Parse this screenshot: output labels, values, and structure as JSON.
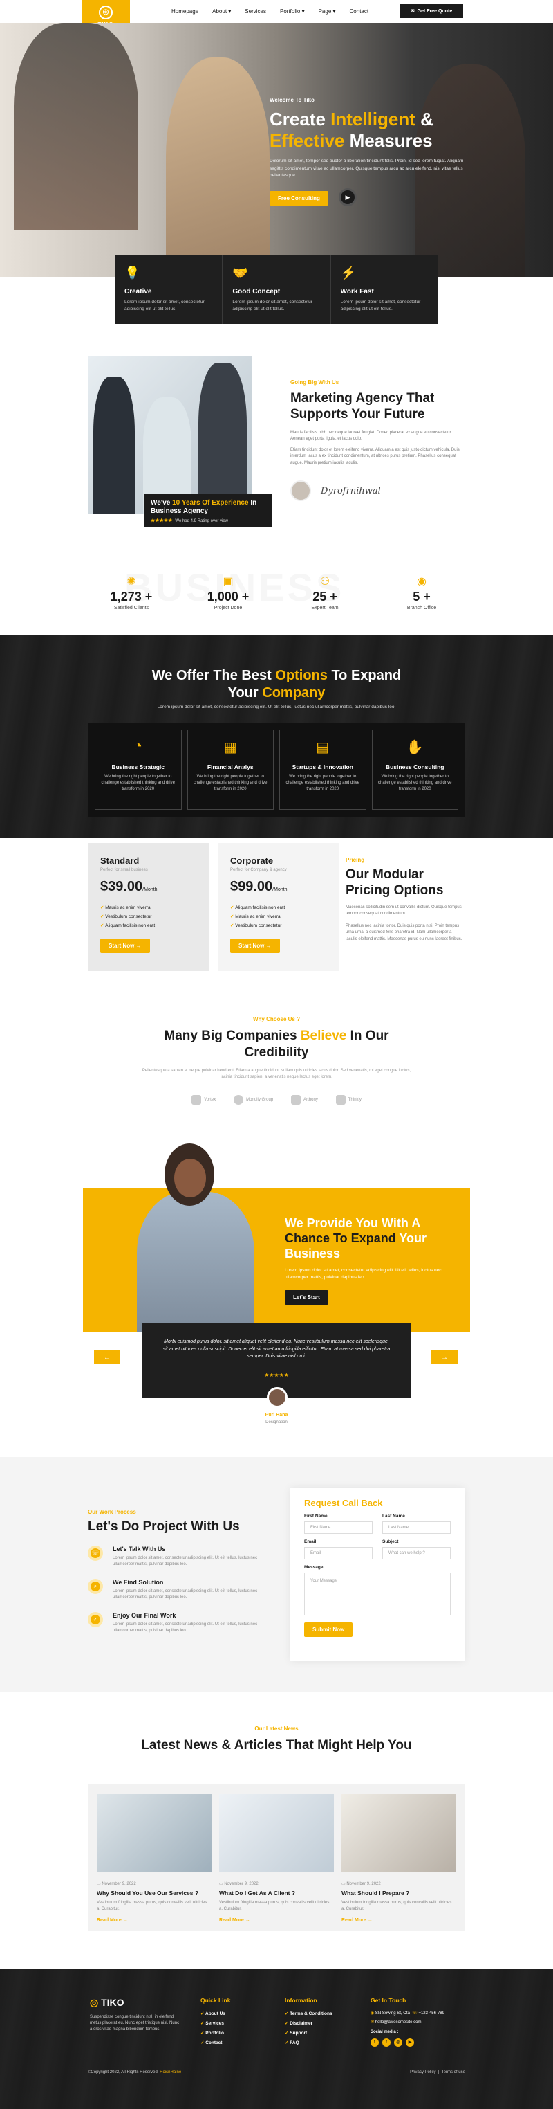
{
  "brand": {
    "name": "TIKO",
    "accent": "#f5b400",
    "dark": "#1b1b1b"
  },
  "nav": {
    "items": [
      "Homepage",
      "About",
      "Services",
      "Portfolio",
      "Page",
      "Contact"
    ],
    "cta": "Get Free Quote"
  },
  "hero": {
    "welcome": "Welcome To Tiko",
    "title_1": "Create ",
    "title_2": "Intelligent",
    "title_3": " &",
    "title_4": "Effective",
    "title_5": " Measures",
    "text": "Dolorum sit amet, tempor sed auctor a liberation tincidunt felis. Proin, id sed lorem fugiat. Aliquam sagittis condimentum vitae ac ullamcorper. Quisque tempus arcu ac arcu eleifend, nisi vitae tellus pellentesque.",
    "cta": "Free Consulting",
    "features": [
      {
        "icon": "lightbulb-icon",
        "title": "Creative",
        "text": "Lorem ipsum dolor sit amet, consectetur adipiscing elit ut elit tellus."
      },
      {
        "icon": "handshake-icon",
        "title": "Good Concept",
        "text": "Lorem ipsum dolor sit amet, consectetur adipiscing elit ut elit tellus."
      },
      {
        "icon": "lightning-icon",
        "title": "Work Fast",
        "text": "Lorem ipsum dolor sit amet, consectetur adipiscing elit ut elit tellus."
      }
    ]
  },
  "about": {
    "eyebrow": "Going Big With Us",
    "title": "Marketing Agency That Supports Your Future",
    "text_1": "Mauris facilisis nibh nec neque laoreet feugiat. Donec placerat ex augue eu consectetur. Aenean eget porta ligula, et lacus odio.",
    "text_2": "Etiam tincidunt dolor et lorem eleifend viverra. Aliquam a est quis justo dictum vehicula. Duis interdum lacus a ex tincidunt condimentum, at ultrices purus pretium. Phasellus consequat augue. Mauris pretium iaculis iaculis.",
    "exp_1": "We've ",
    "exp_2": "10 Years Of Experience",
    "exp_3": " In Business Agency",
    "rating": "We had 4.9 Rating over view",
    "stars": "★★★★★"
  },
  "stats": {
    "watermark": "BUSINESS",
    "items": [
      {
        "icon": "target-icon",
        "num": "1,273 +",
        "label": "Satisfied Clients"
      },
      {
        "icon": "briefcase-icon",
        "num": "1,000 +",
        "label": "Project Done"
      },
      {
        "icon": "team-icon",
        "num": "25 +",
        "label": "Expert Team"
      },
      {
        "icon": "location-icon",
        "num": "5 +",
        "label": "Branch Office"
      }
    ]
  },
  "services": {
    "title_1": "We Offer The Best ",
    "title_2": "Options",
    "title_3": " To Expand",
    "title_4": "Your ",
    "title_5": "Company",
    "sub": "Lorem ipsum dolor sit amet, consectetur adipiscing elit. Ut elit tellus, luctus nec ullamcorper mattis, pulvinar dapibus leo.",
    "items": [
      {
        "icon": "chart-pie-icon",
        "title": "Business Strategic",
        "text": "We bring the right people together to challenge established thinking and drive transform in 2020"
      },
      {
        "icon": "calculator-icon",
        "title": "Financial Analys",
        "text": "We bring the right people together to challenge established thinking and drive transform in 2020"
      },
      {
        "icon": "monitor-icon",
        "title": "Startups & Innovation",
        "text": "We bring the right people together to challenge established thinking and drive transform in 2020"
      },
      {
        "icon": "handshake-icon",
        "title": "Business Consulting",
        "text": "We bring the right people together to challenge established thinking and drive transform in 2020"
      }
    ]
  },
  "pricing": {
    "eyebrow": "Pricing",
    "title": "Our Modular Pricing Options",
    "text_1": "Maecenas sollicitudin sem ut convallis dictum. Quisque tempus tempor consequat condimentum.",
    "text_2": "Phasellus nec lacinia tortor. Duis quis porta nisi. Proin tempus urna urna, a euismod felis pharetra id. Nam ullamcorper a iaculis eleifend mattis. Maecenas purus eu nunc laoreet finibus.",
    "plans": [
      {
        "name": "Standard",
        "sub": "Perfect for small business",
        "price": "$39.00",
        "per": "/Month",
        "features": [
          "Mauris ac enim viverra",
          "Vestibulum consectetur",
          "Aliquam facilisis non erat"
        ],
        "cta": "Start Now →"
      },
      {
        "name": "Corporate",
        "sub": "Perfect for Company & agency",
        "price": "$99.00",
        "per": "/Month",
        "features": [
          "Aliquam facilisis non erat",
          "Mauris ac enim viverra",
          "Vestibulum consectetur"
        ],
        "cta": "Start Now →"
      }
    ]
  },
  "cred": {
    "eyebrow": "Why Choose Us ?",
    "title_1": "Many Big Companies ",
    "title_2": "Believe",
    "title_3": " In Our",
    "title_4": "Credibility",
    "text": "Pellentesque a sapien at neque pulvinar hendrerit. Etiam a augue tincidunt Nullam quis ultricies lacus dolor. Sed venenatis, mi eget congue luctus, lacinia tincidunt sapien, a venenatis neque lectus eget lorem.",
    "logos": [
      "Vortex",
      "Monolly Group",
      "Arthony",
      "Thinkly"
    ]
  },
  "testimonial": {
    "title_1": "We Provide You With A ",
    "title_2": "Chance To Expand",
    "title_3": " Your Business",
    "text": "Lorem ipsum dolor sit amet, consectetur adipiscing elit. Ut elit tellus, luctus nec ullamcorper mattis, pulvinar dapibus leo.",
    "cta": "Let's Start",
    "quote": "Morbi euismod purus dolor, sit amet aliquet velit eleifend eu. Nunc vestibulum massa nec elit scelerisque, sit amet ultrices nulla suscipit. Donec et elit sit amet arcu fringilla efficitur. Etiam at massa sed dui pharetra semper. Duis vitae nisl orci.",
    "stars": "★★★★★",
    "name": "Puri Hana",
    "role": "Designation",
    "prev": "←",
    "next": "→"
  },
  "process": {
    "eyebrow": "Our Work Process",
    "title": "Let's Do Project With Us",
    "steps": [
      {
        "title": "Let's Talk With Us",
        "text": "Lorem ipsum dolor sit amet, consectetur adipiscing elit. Ut elit tellus, luctus nec ullamcorper mattis, pulvinar dapibus leo."
      },
      {
        "title": "We Find Solution",
        "text": "Lorem ipsum dolor sit amet, consectetur adipiscing elit. Ut elit tellus, luctus nec ullamcorper mattis, pulvinar dapibus leo."
      },
      {
        "title": "Enjoy Our Final Work",
        "text": "Lorem ipsum dolor sit amet, consectetur adipiscing elit. Ut elit tellus, luctus nec ullamcorper mattis, pulvinar dapibus leo."
      }
    ]
  },
  "form": {
    "title": "Request Call Back",
    "first_label": "First Name",
    "first_ph": "First Name",
    "last_label": "Last Name",
    "last_ph": "Last Name",
    "email_label": "Email",
    "email_ph": "Email",
    "subject_label": "Subject",
    "subject_ph": "What can we help ?",
    "msg_label": "Message",
    "msg_ph": "Your Message",
    "submit": "Submit Now"
  },
  "news": {
    "eyebrow": "Our Latest News",
    "title": "Latest News & Articles That Might Help You",
    "items": [
      {
        "date": "November 9, 2022",
        "title": "Why Should You Use Our Services ?",
        "text": "Vestibulum fringilla massa purus, quis convallis velit ultricies a. Curabitur.",
        "more": "Read More →"
      },
      {
        "date": "November 9, 2022",
        "title": "What Do I Get As A Client ?",
        "text": "Vestibulum fringilla massa purus, quis convallis velit ultricies a. Curabitur.",
        "more": "Read More →"
      },
      {
        "date": "November 9, 2022",
        "title": "What Should I Prepare ?",
        "text": "Vestibulum fringilla massa purus, quis convallis velit ultricies a. Curabitur.",
        "more": "Read More →"
      }
    ]
  },
  "footer": {
    "desc": "Suspendisse congue tincidunt nisl, in eleifend metus placerat eu. Nunc eget tristique nisl. Nunc a eros vitae magna bibendum tempus.",
    "quick_title": "Quick Link",
    "quick": [
      "About Us",
      "Services",
      "Portfolio",
      "Contact"
    ],
    "info_title": "Information",
    "info": [
      "Terms & Conditions",
      "Disclaimer",
      "Support",
      "FAQ"
    ],
    "touch_title": "Get In Touch",
    "address": "SN Sowing St, Ota",
    "phone": "+123-456-789",
    "email": "hello@awesomesite.com",
    "social_label": "Social media :",
    "copyright_1": "©Copyright 2022, All Rights Reserved. ",
    "copyright_2": "RoisnHalne",
    "privacy": "Privacy Policy",
    "terms": "Terms of use"
  }
}
